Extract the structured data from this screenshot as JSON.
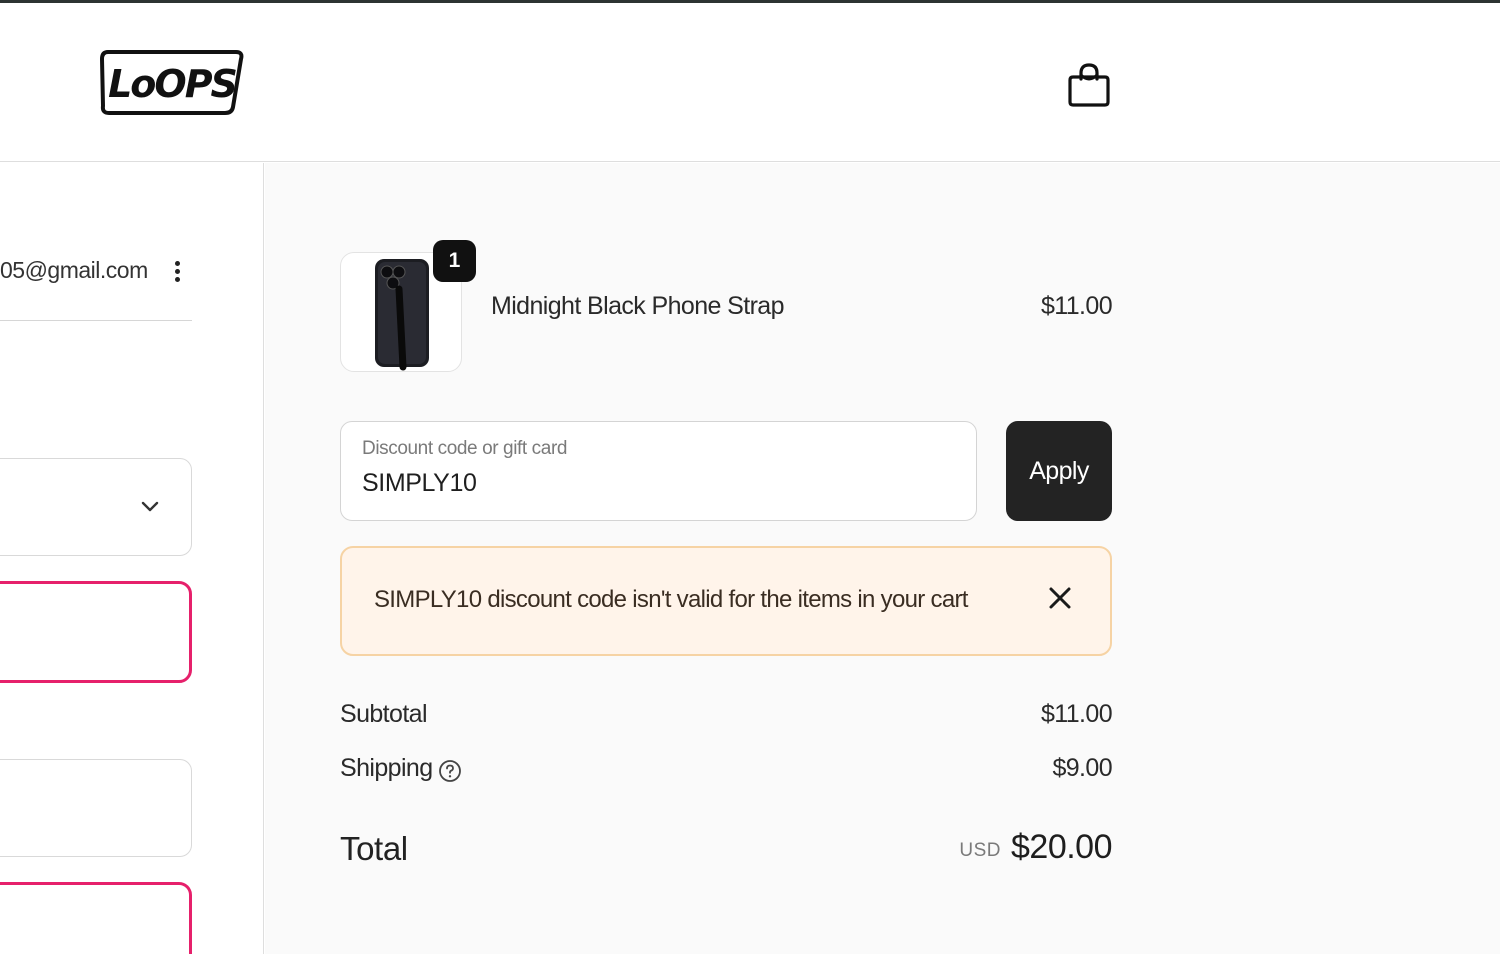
{
  "header": {
    "logo_text": "LoOPS",
    "cart_icon": "shopping-bag-icon"
  },
  "contact": {
    "email": "05@gmail.com",
    "menu_icon": "more-vertical-icon"
  },
  "form": {
    "select_icon": "chevron-down-icon"
  },
  "order": {
    "item": {
      "name": "Midnight Black Phone Strap",
      "price": "$11.00",
      "quantity": "1"
    },
    "discount": {
      "placeholder": "Discount code or gift card",
      "value": "SIMPLY10",
      "apply_label": "Apply"
    },
    "alert": {
      "message": "SIMPLY10 discount code isn't valid for the items in your cart",
      "close_icon": "close-icon"
    },
    "summary": {
      "subtotal_label": "Subtotal",
      "subtotal_value": "$11.00",
      "shipping_label": "Shipping",
      "shipping_value": "$9.00",
      "shipping_help_icon": "question-circle-icon",
      "total_label": "Total",
      "currency": "USD",
      "total_value": "$20.00"
    }
  },
  "colors": {
    "error_border": "#e6206b",
    "alert_bg": "#fff4ea",
    "alert_border": "#f6d3a4",
    "button_bg": "#232323",
    "summary_bg": "#fafafa"
  }
}
